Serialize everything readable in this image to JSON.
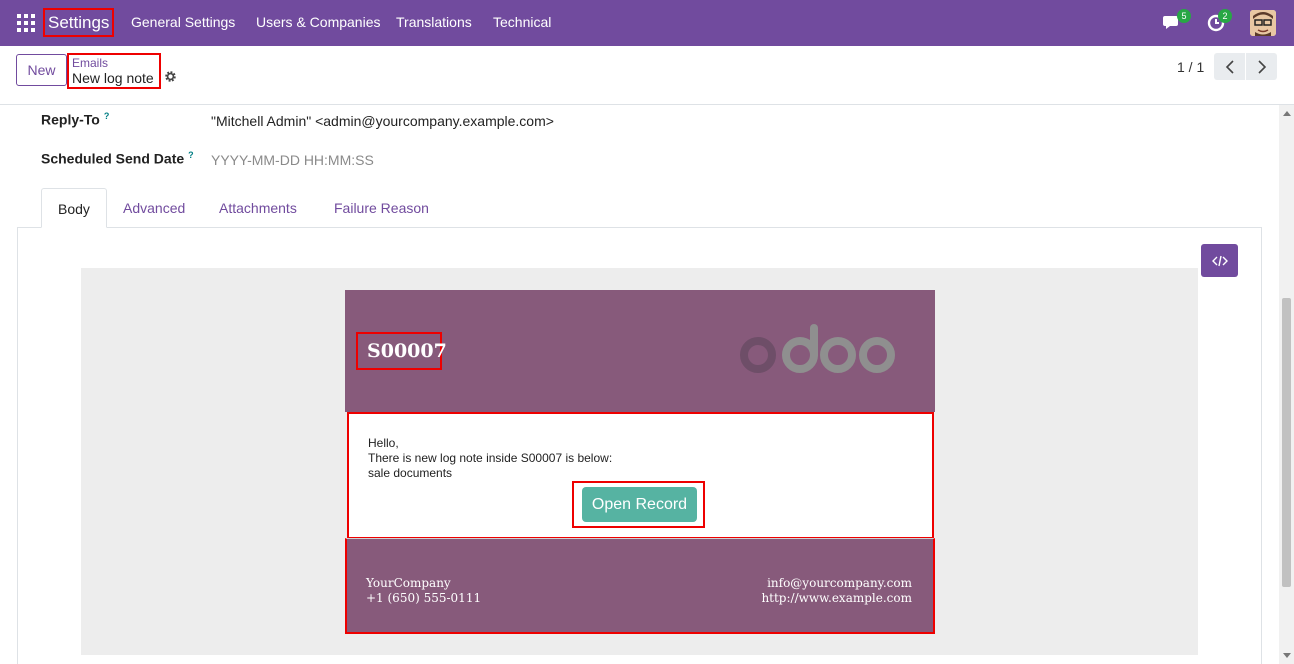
{
  "navbar": {
    "brand": "Settings",
    "menu": [
      "General Settings",
      "Users & Companies",
      "Translations",
      "Technical"
    ],
    "messages_badge": "5",
    "activities_badge": "2"
  },
  "control_panel": {
    "new_label": "New",
    "breadcrumb_parent": "Emails",
    "breadcrumb_current": "New log note",
    "pager": "1 / 1"
  },
  "fields": {
    "reply_to_label": "Reply-To",
    "reply_to_value": "\"Mitchell Admin\" <admin@yourcompany.example.com>",
    "scheduled_label": "Scheduled Send Date",
    "scheduled_placeholder": "YYYY-MM-DD HH:MM:SS",
    "help_mark": "?"
  },
  "tabs": [
    "Body",
    "Advanced",
    "Attachments",
    "Failure Reason"
  ],
  "email": {
    "record_name": "S00007",
    "greeting": "Hello,",
    "line1": "There is new log note inside S00007 is below:",
    "line2": "sale documents",
    "open_record": "Open Record",
    "company": "YourCompany",
    "phone": "+1 (650) 555-0111",
    "email": "info@yourcompany.com",
    "website": "http://www.example.com"
  },
  "colors": {
    "navbar": "#714B9E",
    "email_header": "#875A7B",
    "open_button": "#56b3a2",
    "highlight": "#e00000"
  }
}
